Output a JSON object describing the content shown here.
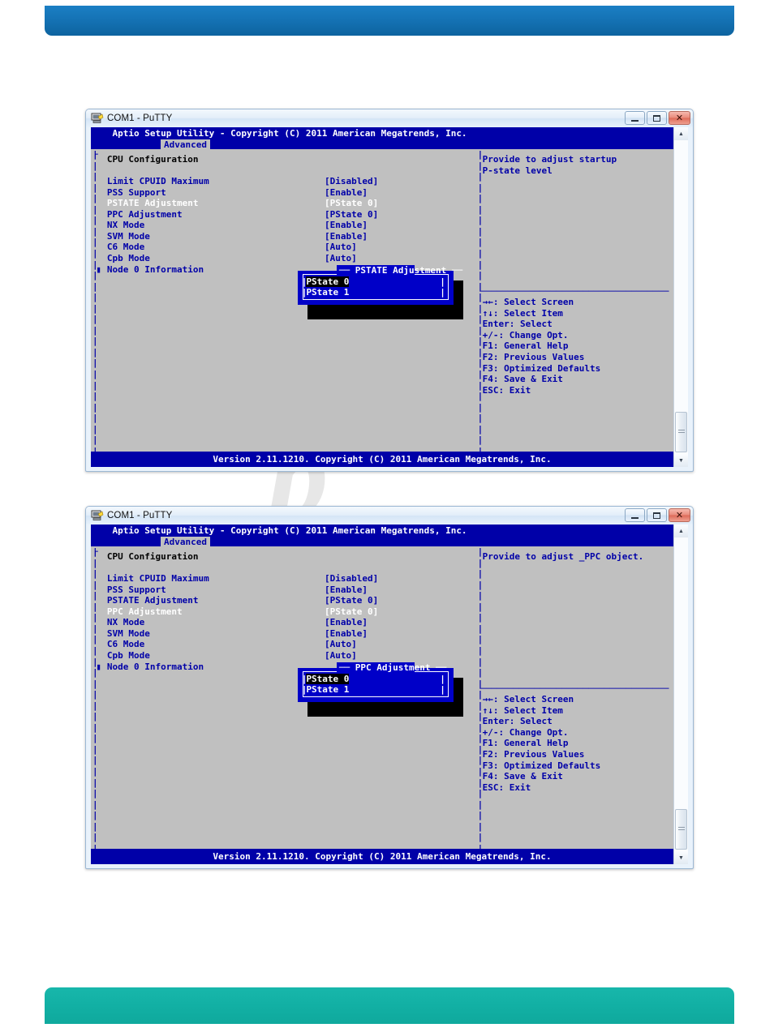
{
  "page": {
    "header_bar_color": "#1573b5",
    "footer_bar_color": "#12b0a4",
    "watermark_text": "p"
  },
  "windows": [
    {
      "title": "COM1 - PuTTY",
      "icon": "putty-icon",
      "controls": {
        "minimize": "–",
        "maximize": "□",
        "close": "✕"
      },
      "bios": {
        "header": "Aptio Setup Utility - Copyright (C) 2011 American Megatrends, Inc.",
        "tab": "Advanced",
        "section_title": "CPU Configuration",
        "items": [
          {
            "label": "Limit CPUID Maximum",
            "value": "[Disabled]",
            "selected": false,
            "submenu": false
          },
          {
            "label": "PSS Support",
            "value": "[Enable]",
            "selected": false,
            "submenu": false
          },
          {
            "label": "PSTATE Adjustment",
            "value": "[PState 0]",
            "selected": true,
            "submenu": false
          },
          {
            "label": "PPC Adjustment",
            "value": "[PState 0]",
            "selected": false,
            "submenu": false
          },
          {
            "label": "NX Mode",
            "value": "[Enable]",
            "selected": false,
            "submenu": false
          },
          {
            "label": "SVM Mode",
            "value": "[Enable]",
            "selected": false,
            "submenu": false
          },
          {
            "label": "C6 Mode",
            "value": "[Auto]",
            "selected": false,
            "submenu": false
          },
          {
            "label": "Cpb Mode",
            "value": "[Auto]",
            "selected": false,
            "submenu": false
          },
          {
            "label": "Node 0 Information",
            "value": "",
            "selected": false,
            "submenu": true
          }
        ],
        "help_lines": [
          "Provide to adjust startup",
          "P-state level"
        ],
        "key_legend": [
          "→←: Select Screen",
          "↑↓: Select Item",
          "Enter: Select",
          "+/-: Change Opt.",
          "F1: General Help",
          "F2: Previous Values",
          "F3: Optimized Defaults",
          "F4: Save & Exit",
          "ESC: Exit"
        ],
        "footer": "Version 2.11.1210. Copyright (C) 2011 American Megatrends, Inc.",
        "popup": {
          "title": "PSTATE Adjustment",
          "options": [
            "PState 0",
            "PState 1"
          ],
          "selected_index": 0
        }
      }
    },
    {
      "title": "COM1 - PuTTY",
      "icon": "putty-icon",
      "controls": {
        "minimize": "–",
        "maximize": "□",
        "close": "✕"
      },
      "bios": {
        "header": "Aptio Setup Utility - Copyright (C) 2011 American Megatrends, Inc.",
        "tab": "Advanced",
        "section_title": "CPU Configuration",
        "items": [
          {
            "label": "Limit CPUID Maximum",
            "value": "[Disabled]",
            "selected": false,
            "submenu": false
          },
          {
            "label": "PSS Support",
            "value": "[Enable]",
            "selected": false,
            "submenu": false
          },
          {
            "label": "PSTATE Adjustment",
            "value": "[PState 0]",
            "selected": false,
            "submenu": false
          },
          {
            "label": "PPC Adjustment",
            "value": "[PState 0]",
            "selected": true,
            "submenu": false
          },
          {
            "label": "NX Mode",
            "value": "[Enable]",
            "selected": false,
            "submenu": false
          },
          {
            "label": "SVM Mode",
            "value": "[Enable]",
            "selected": false,
            "submenu": false
          },
          {
            "label": "C6 Mode",
            "value": "[Auto]",
            "selected": false,
            "submenu": false
          },
          {
            "label": "Cpb Mode",
            "value": "[Auto]",
            "selected": false,
            "submenu": false
          },
          {
            "label": "Node 0 Information",
            "value": "",
            "selected": false,
            "submenu": true
          }
        ],
        "help_lines": [
          "Provide to adjust _PPC object."
        ],
        "key_legend": [
          "→←: Select Screen",
          "↑↓: Select Item",
          "Enter: Select",
          "+/-: Change Opt.",
          "F1: General Help",
          "F2: Previous Values",
          "F3: Optimized Defaults",
          "F4: Save & Exit",
          "ESC: Exit"
        ],
        "footer": "Version 2.11.1210. Copyright (C) 2011 American Megatrends, Inc.",
        "popup": {
          "title": "PPC Adjustment",
          "options": [
            "PState 0",
            "PState 1"
          ],
          "selected_index": 0
        }
      }
    }
  ]
}
